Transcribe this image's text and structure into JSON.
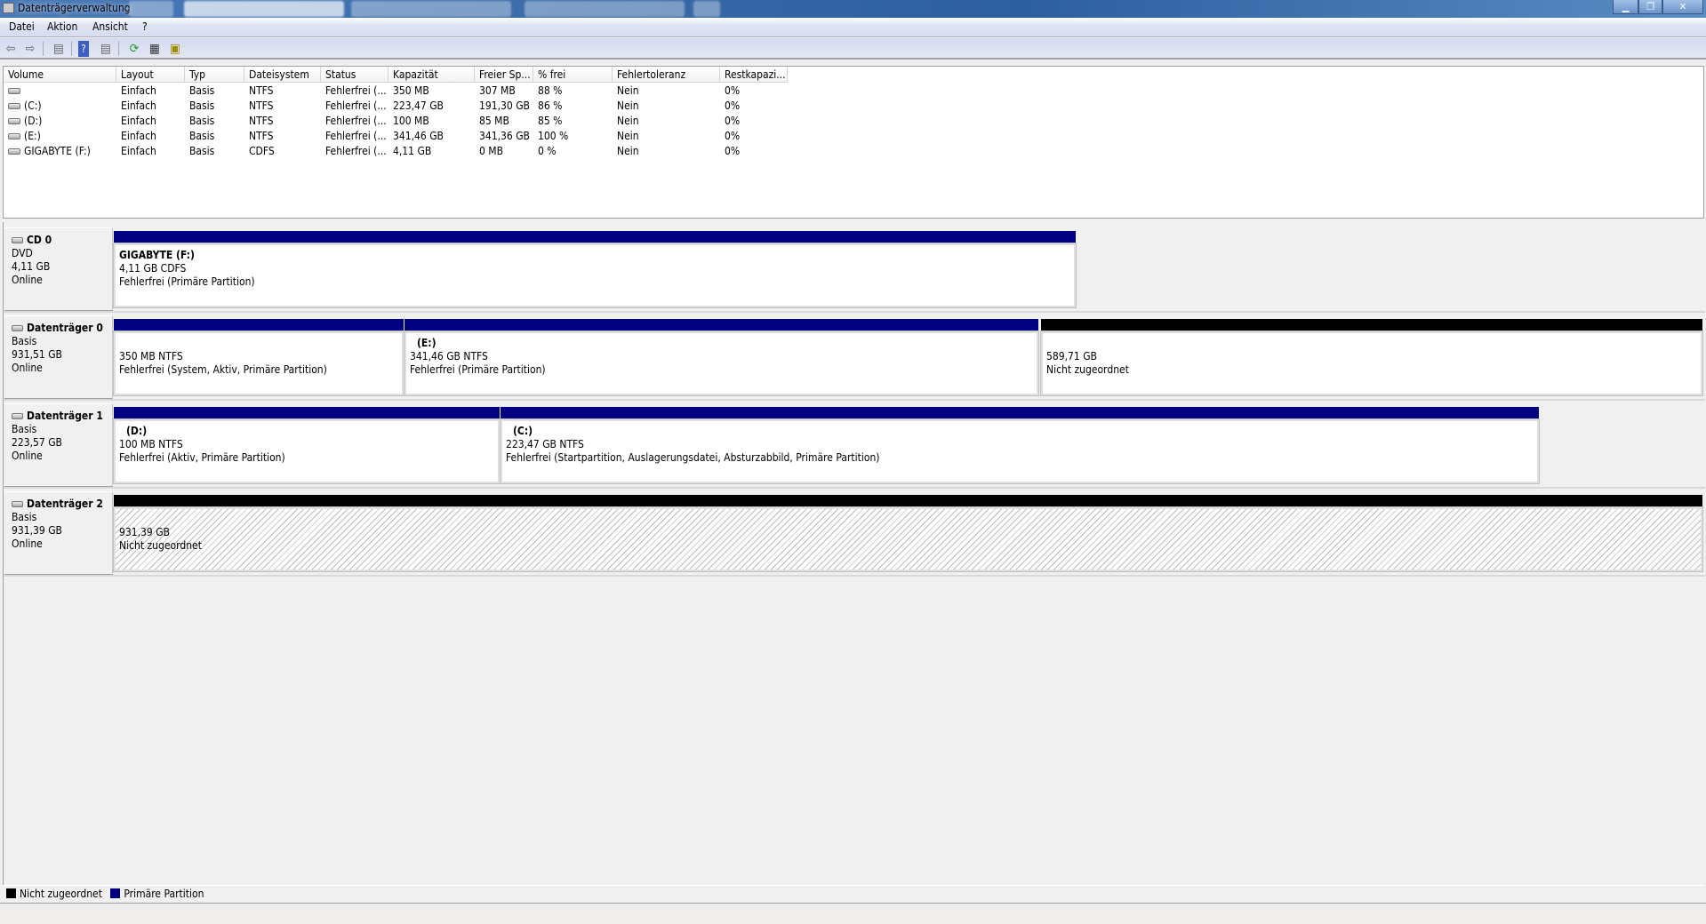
{
  "window": {
    "title": "Datenträgerverwaltung",
    "controls": [
      "minimize",
      "restore",
      "close"
    ]
  },
  "menu": [
    "Datei",
    "Aktion",
    "Ansicht",
    "?"
  ],
  "toolbar": [
    "back-icon",
    "forward-icon",
    "show-hide-console-tree-icon",
    "help-icon",
    "show-hide-action-pane-icon",
    "refresh-icon",
    "properties-icon",
    "rescan-disks-icon"
  ],
  "list": {
    "columns": [
      "Volume",
      "Layout",
      "Typ",
      "Dateisystem",
      "Status",
      "Kapazität",
      "Freier Sp...",
      "% frei",
      "Fehlertoleranz",
      "Restkapazi..."
    ],
    "rows": [
      [
        "",
        "Einfach",
        "Basis",
        "NTFS",
        "Fehlerfrei (...",
        "350 MB",
        "307 MB",
        "88 %",
        "Nein",
        "0%"
      ],
      [
        "(C:)",
        "Einfach",
        "Basis",
        "NTFS",
        "Fehlerfrei (...",
        "223,47 GB",
        "191,30 GB",
        "86 %",
        "Nein",
        "0%"
      ],
      [
        "(D:)",
        "Einfach",
        "Basis",
        "NTFS",
        "Fehlerfrei (...",
        "100 MB",
        "85 MB",
        "85 %",
        "Nein",
        "0%"
      ],
      [
        "(E:)",
        "Einfach",
        "Basis",
        "NTFS",
        "Fehlerfrei (...",
        "341,46 GB",
        "341,36 GB",
        "100 %",
        "Nein",
        "0%"
      ],
      [
        "GIGABYTE (F:)",
        "Einfach",
        "Basis",
        "CDFS",
        "Fehlerfrei (...",
        "4,11 GB",
        "0 MB",
        "0 %",
        "Nein",
        "0%"
      ]
    ]
  },
  "disks": [
    {
      "name": "CD 0",
      "type": "DVD",
      "size": "4,11 GB",
      "state": "Online",
      "icon": "cd-drive-icon",
      "partitions": [
        {
          "title": "GIGABYTE  (F:)",
          "size": "4,11 GB CDFS",
          "status": "Fehlerfrei (Primäre Partition)",
          "kind": "primary"
        }
      ]
    },
    {
      "name": "Datenträger 0",
      "type": "Basis",
      "size": "931,51 GB",
      "state": "Online",
      "icon": "hard-disk-icon",
      "partitions": [
        {
          "title": "",
          "size": "350 MB NTFS",
          "status": "Fehlerfrei (System, Aktiv, Primäre Partition)",
          "kind": "primary"
        },
        {
          "title": "(E:)",
          "size": "341,46 GB NTFS",
          "status": "Fehlerfrei (Primäre Partition)",
          "kind": "primary"
        },
        {
          "title": "",
          "size": "589,71 GB",
          "status": "Nicht zugeordnet",
          "kind": "unallocated"
        }
      ]
    },
    {
      "name": "Datenträger 1",
      "type": "Basis",
      "size": "223,57 GB",
      "state": "Online",
      "icon": "hard-disk-icon",
      "partitions": [
        {
          "title": "(D:)",
          "size": "100 MB NTFS",
          "status": "Fehlerfrei (Aktiv, Primäre Partition)",
          "kind": "primary"
        },
        {
          "title": "(C:)",
          "size": "223,47 GB NTFS",
          "status": "Fehlerfrei (Startpartition, Auslagerungsdatei, Absturzabbild, Primäre Partition)",
          "kind": "primary"
        }
      ]
    },
    {
      "name": "Datenträger 2",
      "type": "Basis",
      "size": "931,39 GB",
      "state": "Online",
      "icon": "hard-disk-icon",
      "partitions": [
        {
          "title": "",
          "size": "931,39 GB",
          "status": "Nicht zugeordnet",
          "kind": "unallocated-hatched"
        }
      ]
    }
  ],
  "legend": [
    {
      "label": "Nicht zugeordnet",
      "color": "#000000"
    },
    {
      "label": "Primäre Partition",
      "color": "#000080"
    }
  ],
  "colors": {
    "primary": "#000080",
    "unallocated": "#000000"
  }
}
